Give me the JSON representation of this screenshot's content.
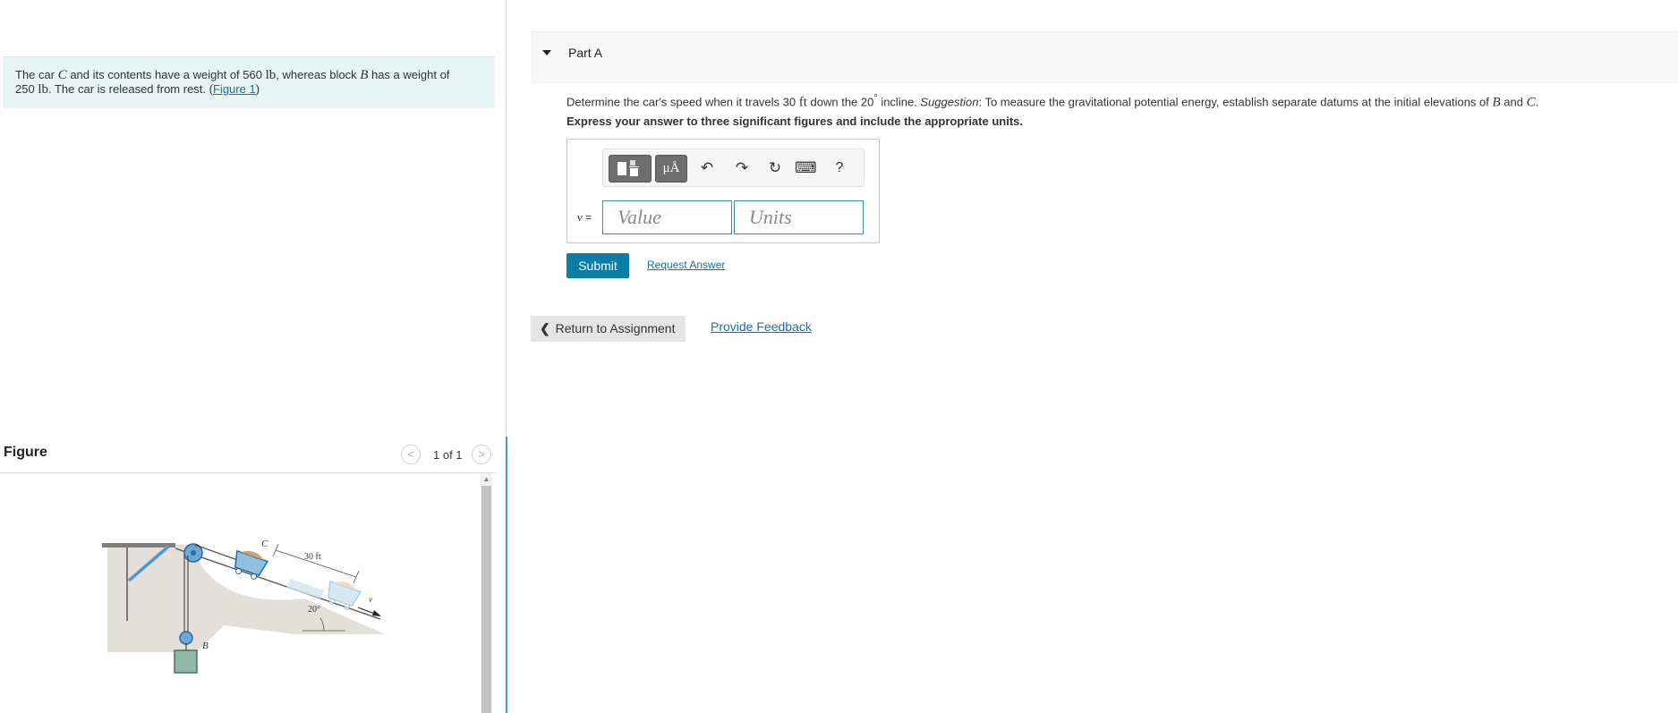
{
  "problem": {
    "t1": "The car ",
    "var_c": "C",
    "t2": " and its contents have a weight of 560 ",
    "unit1": "lb",
    "t3": ", whereas block ",
    "var_b": "B",
    "t4": " has a weight of",
    "t5": "250 ",
    "unit2": "lb",
    "t6": ". The car is released from rest. (",
    "figure_link": "Figure 1",
    "t7": ")"
  },
  "figure": {
    "title": "Figure",
    "counter": "1 of 1",
    "prev_glyph": "<",
    "next_glyph": ">",
    "labels": {
      "c": "C",
      "b": "B",
      "distance": "30 ft",
      "angle": "20°",
      "v": "v"
    }
  },
  "part": {
    "label": "Part A",
    "q1": "Determine the car's speed when it travels 30 ",
    "q_unit": "ft",
    "q2": " down the 20",
    "q_deg": "°",
    "q3": " incline. ",
    "q_suggestion": "Suggestion",
    "q4": ": To measure the gravitational potential energy, establish separate datums at the initial elevations of ",
    "q_b": "B",
    "q5": " and ",
    "q_c": "C",
    "q6": ".",
    "instruction": "Express your answer to three significant figures and include the appropriate units."
  },
  "toolbar": {
    "symbols_label": "μÅ",
    "undo_glyph": "↶",
    "redo_glyph": "↷",
    "reset_glyph": "↻",
    "keyboard_glyph": "⌨",
    "help_glyph": "?"
  },
  "answer": {
    "var": "v",
    "eq": " =",
    "value_placeholder": "Value",
    "units_placeholder": "Units"
  },
  "actions": {
    "submit": "Submit",
    "request_answer": "Request Answer",
    "return_label": "Return to Assignment",
    "feedback": "Provide Feedback"
  },
  "colors": {
    "accent": "#0a7ca8",
    "link": "#1a6fa3",
    "problem_bg": "#e6f4f4",
    "input_border": "#3b8bb8"
  }
}
